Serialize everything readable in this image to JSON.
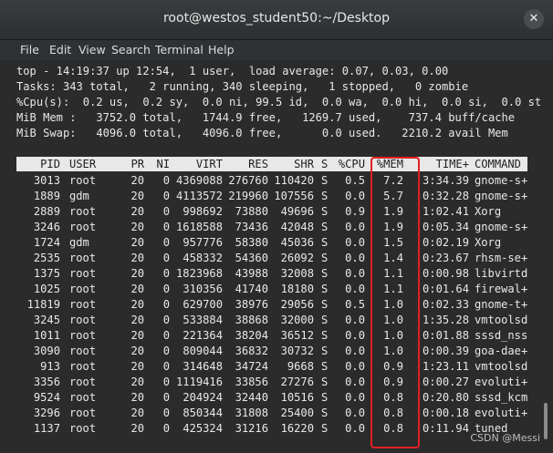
{
  "window": {
    "title": "root@westos_student50:~/Desktop",
    "close_glyph": "✕"
  },
  "menu": [
    "File",
    "Edit",
    "View",
    "Search",
    "Terminal",
    "Help"
  ],
  "summary": [
    "top - 14:19:37 up 12:54,  1 user,  load average: 0.07, 0.03, 0.00",
    "Tasks: 343 total,   2 running, 340 sleeping,   1 stopped,   0 zombie",
    "%Cpu(s):  0.2 us,  0.2 sy,  0.0 ni, 99.5 id,  0.0 wa,  0.0 hi,  0.0 si,  0.0 st",
    "MiB Mem :   3752.0 total,   1744.9 free,   1269.7 used,    737.4 buff/cache",
    "MiB Swap:   4096.0 total,   4096.0 free,      0.0 used.   2210.2 avail Mem"
  ],
  "columns": [
    "PID",
    "USER",
    "PR",
    "NI",
    "VIRT",
    "RES",
    "SHR",
    "S",
    "%CPU",
    "%MEM",
    "TIME+",
    "COMMAND"
  ],
  "processes": [
    [
      "3013",
      "root",
      "20",
      "0",
      "4369088",
      "276760",
      "110420",
      "S",
      "0.5",
      "7.2",
      "3:34.39",
      "gnome-s+"
    ],
    [
      "1889",
      "gdm",
      "20",
      "0",
      "4113572",
      "219960",
      "107556",
      "S",
      "0.0",
      "5.7",
      "0:32.28",
      "gnome-s+"
    ],
    [
      "2889",
      "root",
      "20",
      "0",
      "998692",
      "73880",
      "49696",
      "S",
      "0.9",
      "1.9",
      "1:02.41",
      "Xorg"
    ],
    [
      "3246",
      "root",
      "20",
      "0",
      "1618588",
      "73436",
      "42048",
      "S",
      "0.0",
      "1.9",
      "0:05.34",
      "gnome-s+"
    ],
    [
      "1724",
      "gdm",
      "20",
      "0",
      "957776",
      "58380",
      "45036",
      "S",
      "0.0",
      "1.5",
      "0:02.19",
      "Xorg"
    ],
    [
      "2535",
      "root",
      "20",
      "0",
      "458332",
      "54360",
      "26092",
      "S",
      "0.0",
      "1.4",
      "0:23.67",
      "rhsm-se+"
    ],
    [
      "1375",
      "root",
      "20",
      "0",
      "1823968",
      "43988",
      "32008",
      "S",
      "0.0",
      "1.1",
      "0:00.98",
      "libvirtd"
    ],
    [
      "1025",
      "root",
      "20",
      "0",
      "310356",
      "41740",
      "18180",
      "S",
      "0.0",
      "1.1",
      "0:01.64",
      "firewal+"
    ],
    [
      "11819",
      "root",
      "20",
      "0",
      "629700",
      "38976",
      "29056",
      "S",
      "0.5",
      "1.0",
      "0:02.33",
      "gnome-t+"
    ],
    [
      "3245",
      "root",
      "20",
      "0",
      "533884",
      "38868",
      "32000",
      "S",
      "0.0",
      "1.0",
      "1:35.28",
      "vmtoolsd"
    ],
    [
      "1011",
      "root",
      "20",
      "0",
      "221364",
      "38204",
      "36512",
      "S",
      "0.0",
      "1.0",
      "0:01.88",
      "sssd_nss"
    ],
    [
      "3090",
      "root",
      "20",
      "0",
      "809044",
      "36832",
      "30732",
      "S",
      "0.0",
      "1.0",
      "0:00.39",
      "goa-dae+"
    ],
    [
      "913",
      "root",
      "20",
      "0",
      "314648",
      "34724",
      "9668",
      "S",
      "0.0",
      "0.9",
      "1:23.11",
      "vmtoolsd"
    ],
    [
      "3356",
      "root",
      "20",
      "0",
      "1119416",
      "33856",
      "27276",
      "S",
      "0.0",
      "0.9",
      "0:00.27",
      "evoluti+"
    ],
    [
      "9524",
      "root",
      "20",
      "0",
      "204924",
      "32440",
      "10516",
      "S",
      "0.0",
      "0.8",
      "0:20.80",
      "sssd_kcm"
    ],
    [
      "3296",
      "root",
      "20",
      "0",
      "850344",
      "31808",
      "25400",
      "S",
      "0.0",
      "0.8",
      "0:00.18",
      "evoluti+"
    ],
    [
      "1137",
      "root",
      "20",
      "0",
      "425324",
      "31216",
      "16220",
      "S",
      "0.0",
      "0.8",
      "0:11.94",
      "tuned"
    ]
  ],
  "watermark": "CSDN @Messi"
}
